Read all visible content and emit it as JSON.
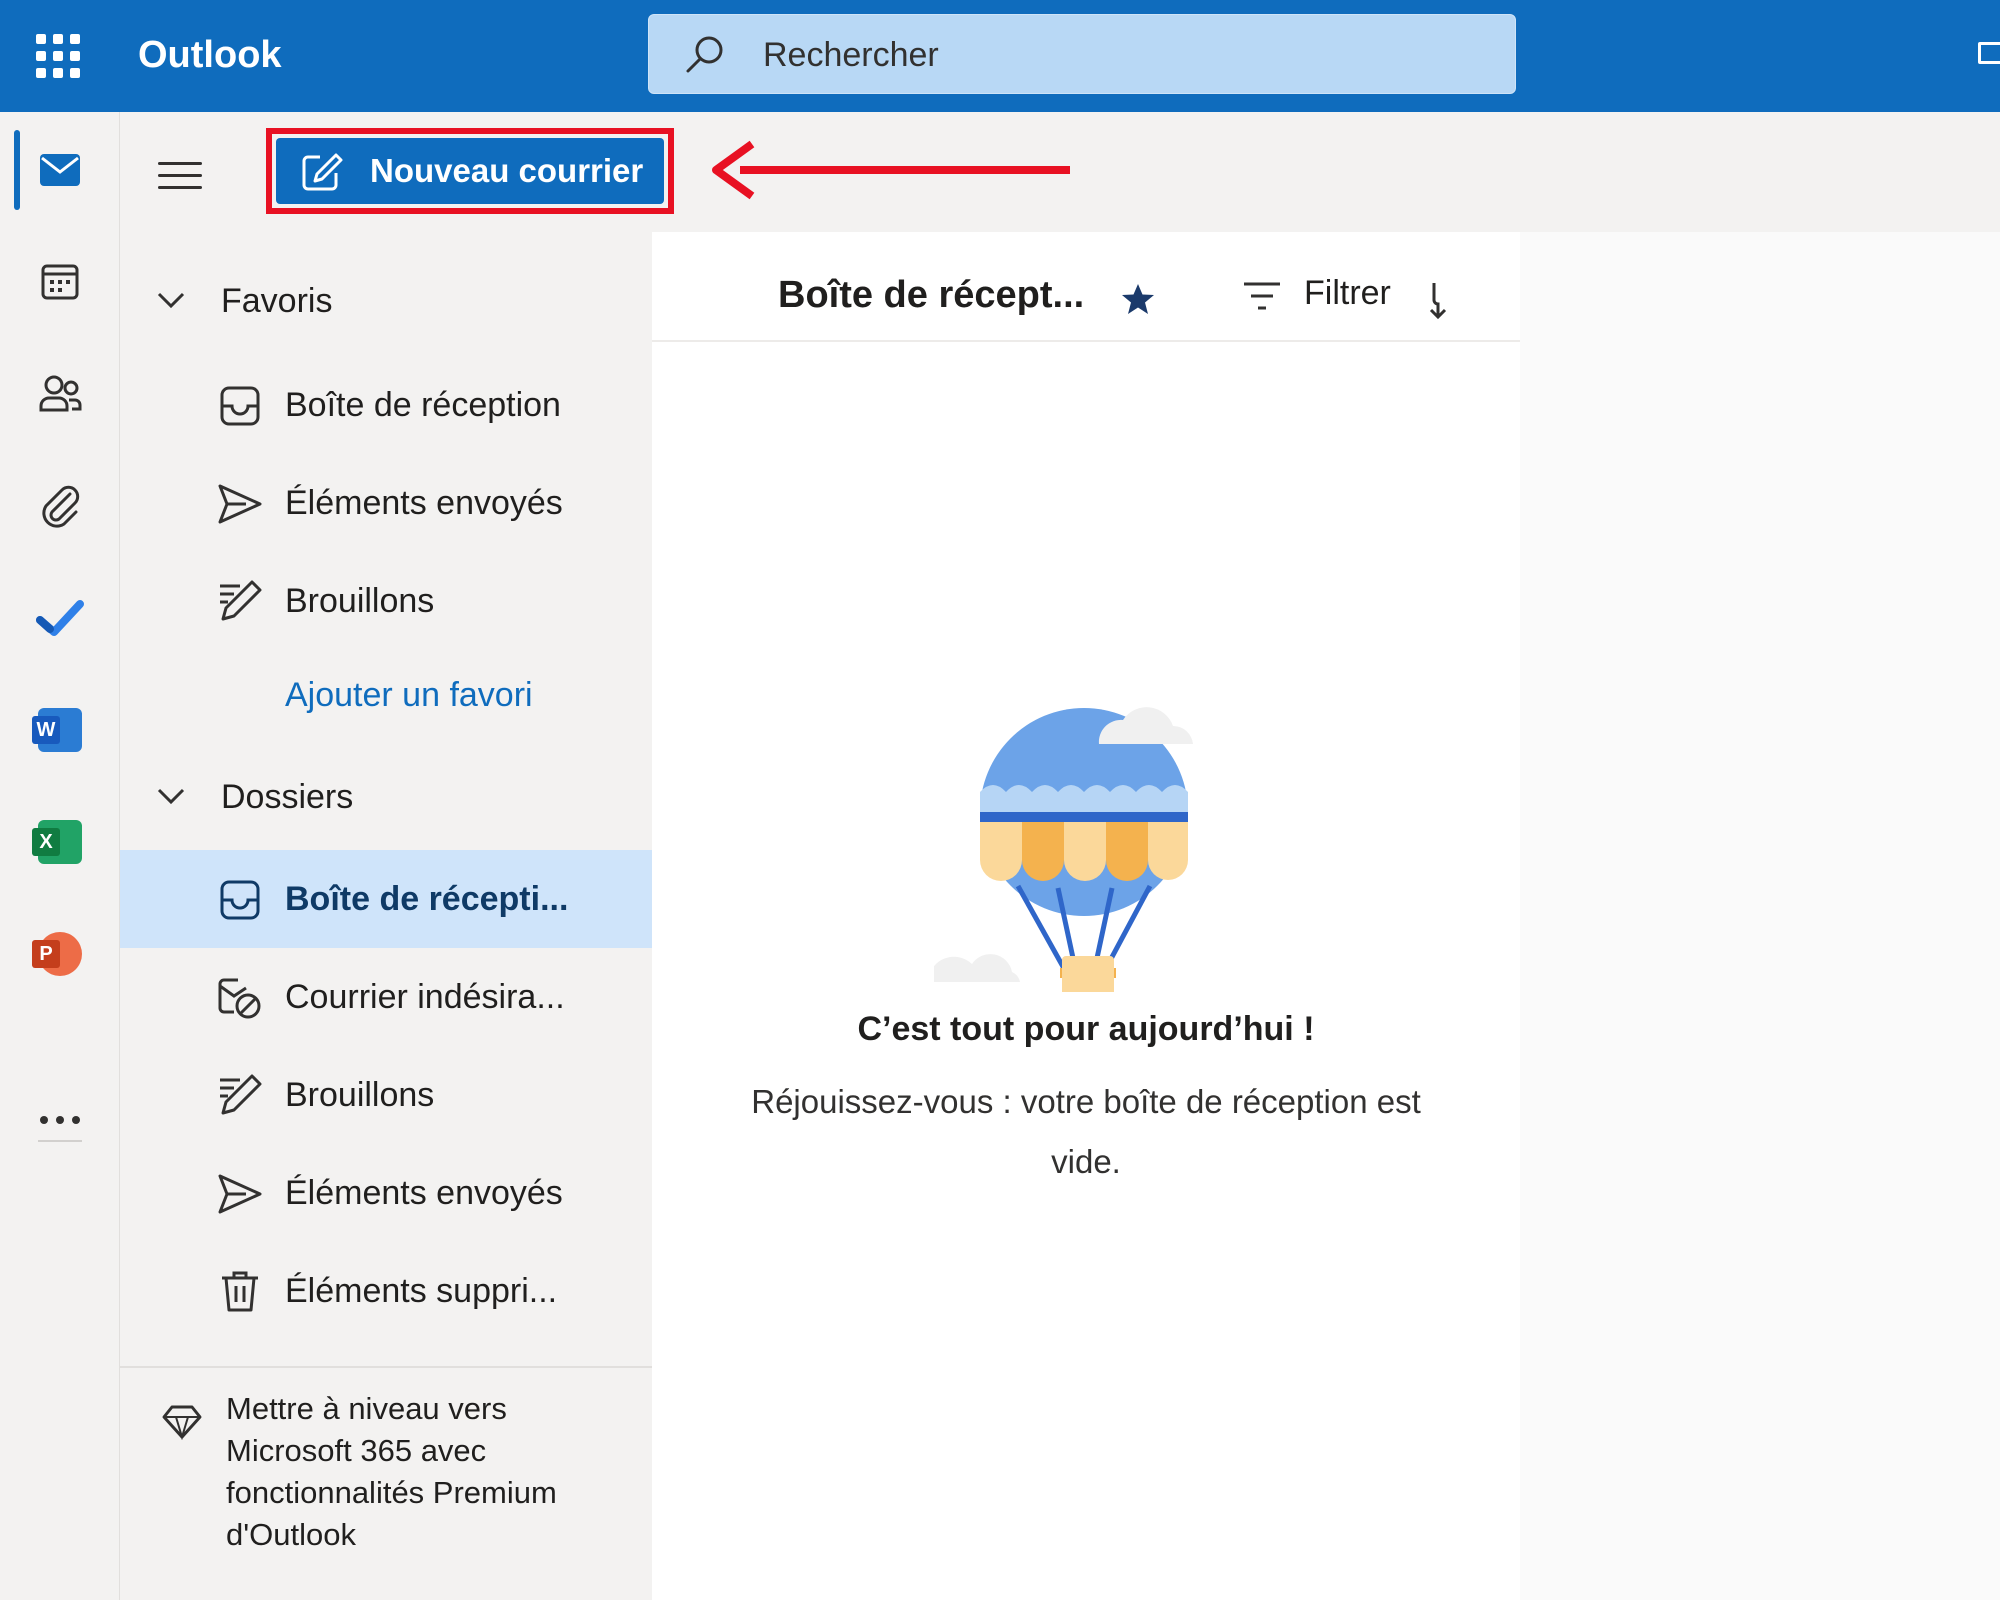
{
  "app": {
    "title": "Outlook"
  },
  "search": {
    "placeholder": "Rechercher"
  },
  "rail": {
    "items": [
      {
        "name": "mail-icon",
        "active": true
      },
      {
        "name": "calendar-icon"
      },
      {
        "name": "people-icon"
      },
      {
        "name": "attachment-icon"
      },
      {
        "name": "todo-icon"
      },
      {
        "name": "word-icon",
        "letter": "W"
      },
      {
        "name": "excel-icon",
        "letter": "X"
      },
      {
        "name": "powerpoint-icon",
        "letter": "P"
      },
      {
        "name": "more-apps-icon"
      }
    ]
  },
  "toolbar": {
    "new_mail_label": "Nouveau courrier"
  },
  "folders": {
    "favorites_header": "Favoris",
    "favorites": [
      {
        "label": "Boîte de réception",
        "icon": "inbox-icon"
      },
      {
        "label": "Éléments envoyés",
        "icon": "send-icon"
      },
      {
        "label": "Brouillons",
        "icon": "drafts-icon"
      }
    ],
    "add_favorite": "Ajouter un favori",
    "folders_header": "Dossiers",
    "list": [
      {
        "label": "Boîte de récepti...",
        "icon": "inbox-icon",
        "selected": true
      },
      {
        "label": "Courrier indésira...",
        "icon": "junk-icon"
      },
      {
        "label": "Brouillons",
        "icon": "drafts-icon"
      },
      {
        "label": "Éléments envoyés",
        "icon": "send-icon"
      },
      {
        "label": "Éléments suppri...",
        "icon": "trash-icon"
      }
    ],
    "upgrade_text": "Mettre à niveau vers Microsoft 365 avec fonctionnalités Premium d'Outlook"
  },
  "message_list": {
    "title": "Boîte de récept...",
    "filter_label": "Filtrer",
    "empty_title": "C’est tout pour aujourd’hui !",
    "empty_subtitle": "Réjouissez-vous : votre boîte de réception est vide."
  },
  "colors": {
    "brand": "#0f6cbd",
    "highlight": "#e81123",
    "selected_folder": "#cfe4fa"
  }
}
